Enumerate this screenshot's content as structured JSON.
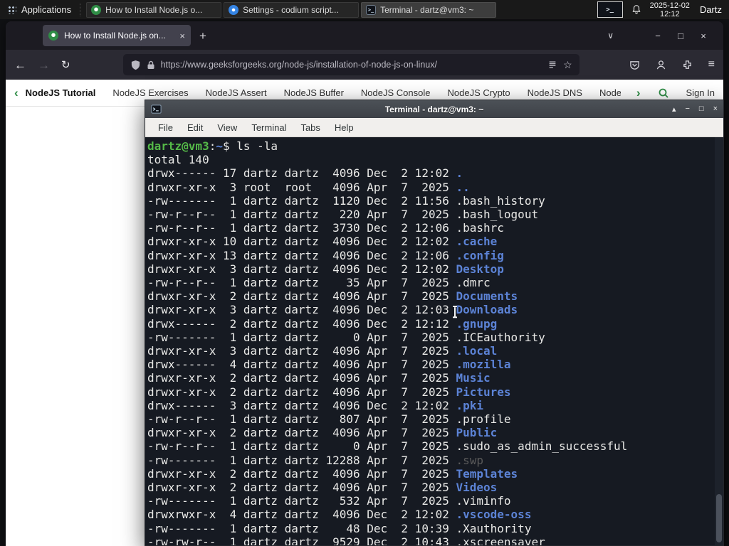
{
  "panel": {
    "applications_label": "Applications",
    "tasks": [
      {
        "label": "How to Install Node.js o..."
      },
      {
        "label": "Settings - codium script..."
      },
      {
        "label": "Terminal - dartz@vm3: ~"
      }
    ],
    "terminal_glyph": ">_",
    "tray_terminal_glyph": ">_",
    "clock_date": "2025-12-02",
    "clock_time": "12:12",
    "user_label": "Dartz"
  },
  "browser": {
    "tab": {
      "title": "How to Install Node.js on...",
      "close_glyph": "×"
    },
    "new_tab_glyph": "+",
    "all_tabs_glyph": "∨",
    "window_controls": {
      "minimize": "−",
      "maximize": "□",
      "close": "×"
    },
    "nav": {
      "back_glyph": "←",
      "forward_glyph": "→",
      "refresh_glyph": "↻"
    },
    "urlbar": {
      "url": "https://www.geeksforgeeks.org/node-js/installation-of-node-js-on-linux/",
      "bookmark_glyph": "☆"
    },
    "menu_glyph": "≡"
  },
  "site_nav": {
    "prev_glyph": "‹",
    "next_glyph": "›",
    "items": [
      "NodeJS Tutorial",
      "NodeJS Exercises",
      "NodeJS Assert",
      "NodeJS Buffer",
      "NodeJS Console",
      "NodeJS Crypto",
      "NodeJS DNS",
      "Node"
    ],
    "sign_in_label": "Sign In"
  },
  "terminal": {
    "window_title": "Terminal - dartz@vm3: ~",
    "window_controls": {
      "shade": "▴",
      "minimize": "−",
      "maximize": "□",
      "close": "×"
    },
    "menus": [
      "File",
      "Edit",
      "View",
      "Terminal",
      "Tabs",
      "Help"
    ],
    "prompt": {
      "user": "dartz@vm3",
      "colon": ":",
      "path": "~",
      "dollar": "$ ",
      "command": "ls -la"
    },
    "total_line": "total 140",
    "listing": [
      {
        "p": "drwx------ 17 dartz dartz  4096 Dec  2 12:02 ",
        "n": ".",
        "c": "d"
      },
      {
        "p": "drwxr-xr-x  3 root  root   4096 Apr  7  2025 ",
        "n": "..",
        "c": "d"
      },
      {
        "p": "-rw-------  1 dartz dartz  1120 Dec  2 11:56 ",
        "n": ".bash_history",
        "c": "f"
      },
      {
        "p": "-rw-r--r--  1 dartz dartz   220 Apr  7  2025 ",
        "n": ".bash_logout",
        "c": "f"
      },
      {
        "p": "-rw-r--r--  1 dartz dartz  3730 Dec  2 12:06 ",
        "n": ".bashrc",
        "c": "f"
      },
      {
        "p": "drwxr-xr-x 10 dartz dartz  4096 Dec  2 12:02 ",
        "n": ".cache",
        "c": "d"
      },
      {
        "p": "drwxr-xr-x 13 dartz dartz  4096 Dec  2 12:06 ",
        "n": ".config",
        "c": "d"
      },
      {
        "p": "drwxr-xr-x  3 dartz dartz  4096 Dec  2 12:02 ",
        "n": "Desktop",
        "c": "d"
      },
      {
        "p": "-rw-r--r--  1 dartz dartz    35 Apr  7  2025 ",
        "n": ".dmrc",
        "c": "f"
      },
      {
        "p": "drwxr-xr-x  2 dartz dartz  4096 Apr  7  2025 ",
        "n": "Documents",
        "c": "d"
      },
      {
        "p": "drwxr-xr-x  3 dartz dartz  4096 Dec  2 12:03 ",
        "n": "Downloads",
        "c": "d"
      },
      {
        "p": "drwx------  2 dartz dartz  4096 Dec  2 12:12 ",
        "n": ".gnupg",
        "c": "d"
      },
      {
        "p": "-rw-------  1 dartz dartz     0 Apr  7  2025 ",
        "n": ".ICEauthority",
        "c": "f"
      },
      {
        "p": "drwxr-xr-x  3 dartz dartz  4096 Apr  7  2025 ",
        "n": ".local",
        "c": "d"
      },
      {
        "p": "drwx------  4 dartz dartz  4096 Apr  7  2025 ",
        "n": ".mozilla",
        "c": "d"
      },
      {
        "p": "drwxr-xr-x  2 dartz dartz  4096 Apr  7  2025 ",
        "n": "Music",
        "c": "d"
      },
      {
        "p": "drwxr-xr-x  2 dartz dartz  4096 Apr  7  2025 ",
        "n": "Pictures",
        "c": "d"
      },
      {
        "p": "drwx------  3 dartz dartz  4096 Dec  2 12:02 ",
        "n": ".pki",
        "c": "d"
      },
      {
        "p": "-rw-r--r--  1 dartz dartz   807 Apr  7  2025 ",
        "n": ".profile",
        "c": "f"
      },
      {
        "p": "drwxr-xr-x  2 dartz dartz  4096 Apr  7  2025 ",
        "n": "Public",
        "c": "d"
      },
      {
        "p": "-rw-r--r--  1 dartz dartz     0 Apr  7  2025 ",
        "n": ".sudo_as_admin_successful",
        "c": "f"
      },
      {
        "p": "-rw-------  1 dartz dartz 12288 Apr  7  2025 ",
        "n": ".swp",
        "c": "x"
      },
      {
        "p": "drwxr-xr-x  2 dartz dartz  4096 Apr  7  2025 ",
        "n": "Templates",
        "c": "d"
      },
      {
        "p": "drwxr-xr-x  2 dartz dartz  4096 Apr  7  2025 ",
        "n": "Videos",
        "c": "d"
      },
      {
        "p": "-rw-------  1 dartz dartz   532 Apr  7  2025 ",
        "n": ".viminfo",
        "c": "f"
      },
      {
        "p": "drwxrwxr-x  4 dartz dartz  4096 Dec  2 12:02 ",
        "n": ".vscode-oss",
        "c": "d"
      },
      {
        "p": "-rw-------  1 dartz dartz    48 Dec  2 10:39 ",
        "n": ".Xauthority",
        "c": "f"
      },
      {
        "p": "-rw-rw-r--  1 dartz dartz  9529 Dec  2 10:43 ",
        "n": ".xscreensaver",
        "c": "f"
      }
    ]
  },
  "colors": {
    "gfg_green": "#2f8d46",
    "terminal_green": "#55b948",
    "terminal_blue": "#5c83d6",
    "terminal_dim": "#5a5a5a",
    "terminal_bg": "#161a22",
    "panel_bg": "#191919",
    "firefox_toolbar": "#2b2a33"
  }
}
